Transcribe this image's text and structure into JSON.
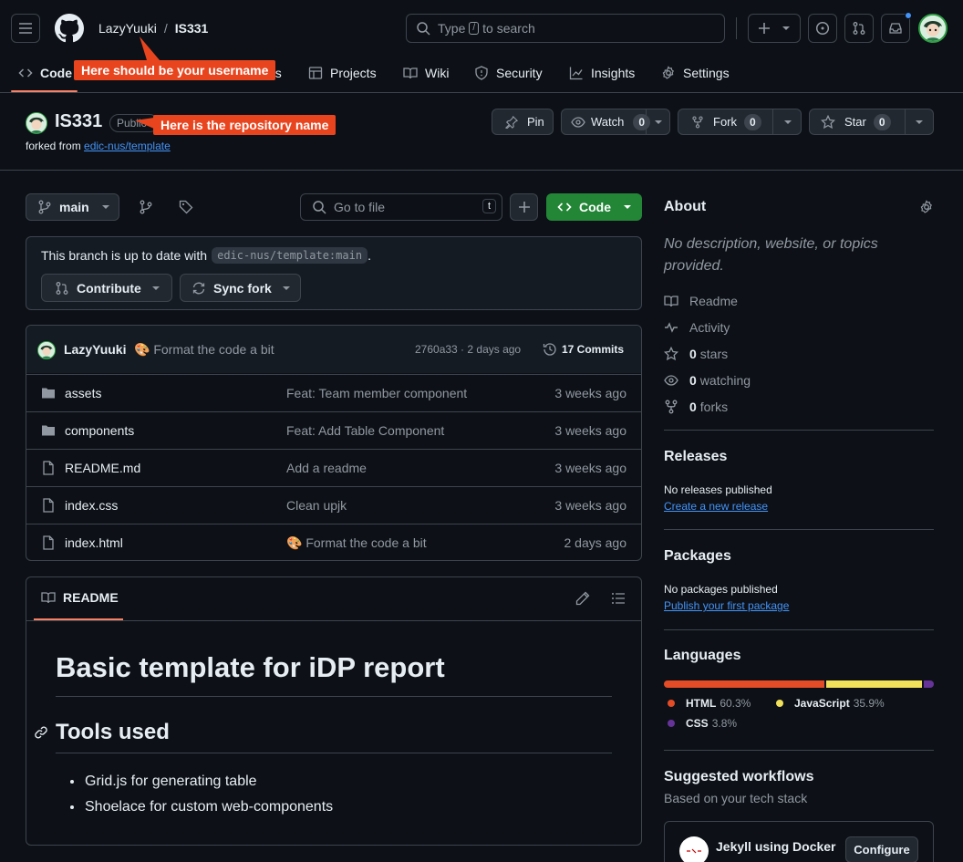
{
  "header": {
    "owner": "LazyYuuki",
    "separator": "/",
    "repo": "IS331",
    "search_prefix": "Type",
    "search_key": "/",
    "search_suffix": "to search"
  },
  "annotations": {
    "username": "Here should be your username",
    "repo_name": "Here is the repository name"
  },
  "tabs": [
    {
      "label": "Code"
    },
    {
      "label": "ns"
    },
    {
      "label": "Projects"
    },
    {
      "label": "Wiki"
    },
    {
      "label": "Security"
    },
    {
      "label": "Insights"
    },
    {
      "label": "Settings"
    }
  ],
  "repo": {
    "name": "IS331",
    "visibility": "Public",
    "forked_from_label": "forked from",
    "forked_from": "edic-nus/template",
    "pin": "Pin",
    "watch": "Watch",
    "watch_count": "0",
    "fork": "Fork",
    "fork_count": "0",
    "star": "Star",
    "star_count": "0"
  },
  "toolbar": {
    "branch": "main",
    "go_to_file": "Go to file",
    "go_to_file_key": "t",
    "code": "Code"
  },
  "branch_status": {
    "text": "This branch is up to date with",
    "ref": "edic-nus/template:main",
    "period": ".",
    "contribute": "Contribute",
    "sync_fork": "Sync fork"
  },
  "commit": {
    "author": "LazyYuuki",
    "emoji": "🎨",
    "message": "Format the code a bit",
    "hash_time": "2760a33 · 2 days ago",
    "commits": "17 Commits"
  },
  "files": [
    {
      "type": "folder",
      "name": "assets",
      "message": "Feat: Team member component",
      "date": "3 weeks ago"
    },
    {
      "type": "folder",
      "name": "components",
      "message": "Feat: Add Table Component",
      "date": "3 weeks ago"
    },
    {
      "type": "file",
      "name": "README.md",
      "message": "Add a readme",
      "date": "3 weeks ago"
    },
    {
      "type": "file",
      "name": "index.css",
      "message": "Clean upjk",
      "date": "3 weeks ago"
    },
    {
      "type": "file",
      "name": "index.html",
      "message": "🎨 Format the code a bit",
      "date": "2 days ago"
    }
  ],
  "readme": {
    "tab": "README",
    "h1": "Basic template for iDP report",
    "h2": "Tools used",
    "items": [
      "Grid.js for generating table",
      "Shoelace for custom web-components"
    ]
  },
  "about": {
    "title": "About",
    "description": "No description, website, or topics provided.",
    "readme": "Readme",
    "activity": "Activity",
    "stars_count": "0",
    "stars": "stars",
    "watching_count": "0",
    "watching": "watching",
    "forks_count": "0",
    "forks": "forks"
  },
  "releases": {
    "title": "Releases",
    "none": "No releases published",
    "create": "Create a new release"
  },
  "packages": {
    "title": "Packages",
    "none": "No packages published",
    "publish": "Publish your first package"
  },
  "languages": {
    "title": "Languages",
    "items": [
      {
        "name": "HTML",
        "percent": "60.3%",
        "value": 60.3,
        "color": "#e34c26"
      },
      {
        "name": "JavaScript",
        "percent": "35.9%",
        "value": 35.9,
        "color": "#f1e05a"
      },
      {
        "name": "CSS",
        "percent": "3.8%",
        "value": 3.8,
        "color": "#663399"
      }
    ]
  },
  "workflows": {
    "title": "Suggested workflows",
    "subtitle": "Based on your tech stack",
    "item": "Jekyll using Docker",
    "configure": "Configure"
  },
  "colors": {
    "accent": "#238636",
    "link": "#4493f8",
    "callout": "#e8451f",
    "tab_underline": "#f78166"
  }
}
